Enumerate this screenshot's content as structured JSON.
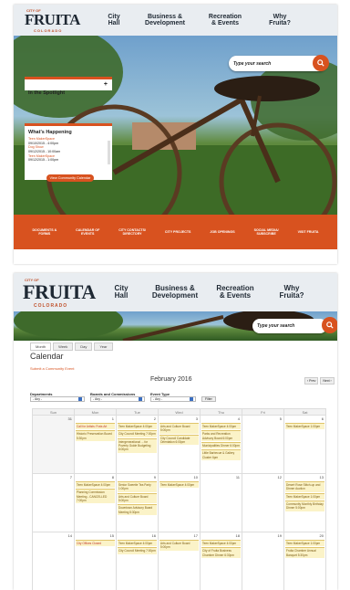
{
  "site": {
    "city_of": "City of",
    "name": "FRUITA",
    "state": "COLORADO"
  },
  "nav": [
    {
      "label": "City\nHall"
    },
    {
      "label": "Business &\nDevelopment"
    },
    {
      "label": "Recreation\n& Events"
    },
    {
      "label": "Why\nFruita?"
    }
  ],
  "search": {
    "placeholder": "Type your search",
    "icon": "magnifier-icon"
  },
  "home": {
    "spotlight_title": "In the Spotlight",
    "spotlight_toggle": "+",
    "happening_title": "What's Happening",
    "happening_items": [
      {
        "title": "Teen MakerSpace",
        "date": "09/10/2015 - 4:00pm"
      },
      {
        "title": "Dog Show",
        "date": "09/12/2015 - 10:00am"
      },
      {
        "title": "Teen MakerSpace",
        "date": "09/12/2015 - 1:00pm"
      }
    ],
    "view_calendar_button": "View Community Calendar",
    "quicklinks": [
      "DOCUMENTS &\nFORMS",
      "CALENDAR OF\nEVENTS",
      "CITY CONTACTS/\nDIRECTORY",
      "CITY PROJECTS",
      "JOB OPENINGS",
      "SOCIAL MEDIA/\nSUBSCRIBE",
      "VISIT FRUITA"
    ]
  },
  "calendar": {
    "tabs": [
      "Month",
      "Week",
      "Day",
      "Year"
    ],
    "active_tab": "Month",
    "page_title": "Calendar",
    "submit_link": "Submit a Community Event",
    "month_title": "February 2016",
    "prev": "‹ Prev",
    "next": "Next ›",
    "filters": [
      {
        "label": "Departments",
        "value": "- Any -"
      },
      {
        "label": "Boards and Commissions",
        "value": "- Any -"
      },
      {
        "label": "Event Type",
        "value": "- Any -"
      }
    ],
    "filter_button": "Filter",
    "weekdays": [
      "Sun",
      "Mon",
      "Tue",
      "Wed",
      "Thu",
      "Fri",
      "Sat"
    ],
    "weeks": [
      [
        {
          "day": "31",
          "other": true,
          "events": []
        },
        {
          "day": "1",
          "events": [
            {
              "t": "Call for Artists: Frais Art",
              "red": true
            },
            {
              "t": "Historic Preservation Board 5:30pm"
            }
          ]
        },
        {
          "day": "2",
          "events": [
            {
              "t": "Teen MakerSpace 4:00pm"
            },
            {
              "t": "City Council Meeting 7:00pm"
            },
            {
              "t": "Intergenerational ... for Poverty Guide Budgeting 6:00pm"
            }
          ]
        },
        {
          "day": "3",
          "events": [
            {
              "t": "Arts and Culture Board 5:00pm"
            },
            {
              "t": "City Council Candidate Orientation 6:00pm"
            }
          ]
        },
        {
          "day": "4",
          "events": [
            {
              "t": "Teen MakerSpace 4:00pm"
            },
            {
              "t": "Parks and Recreation Advisory Board 6:00pm"
            },
            {
              "t": "Municipalities Dinner 6:00pm"
            },
            {
              "t": "Little Barbecue & Gallery Cluster 6pm"
            }
          ]
        },
        {
          "day": "5",
          "events": []
        },
        {
          "day": "6",
          "events": [
            {
              "t": "Teen MakerSpace 1:00pm"
            }
          ]
        }
      ],
      [
        {
          "day": "7",
          "events": []
        },
        {
          "day": "8",
          "events": [
            {
              "t": "Teen MakerSpace 4:00pm"
            },
            {
              "t": "Planning Commission Meeting - CANCELLED 7:00pm"
            }
          ]
        },
        {
          "day": "9",
          "events": [
            {
              "t": "Senior Sweetie Tea Party 1:00pm"
            },
            {
              "t": "Arts and Culture Board 5:00pm"
            },
            {
              "t": "Downtown Advisory Board Meeting 5:30pm"
            }
          ]
        },
        {
          "day": "10",
          "events": [
            {
              "t": "Teen MakerSpace 4:00pm"
            }
          ]
        },
        {
          "day": "11",
          "events": []
        },
        {
          "day": "12",
          "events": []
        },
        {
          "day": "13",
          "events": [
            {
              "t": "Desert Rose Stitch-up and Dinner Auction"
            },
            {
              "t": "Teen MakerSpace 1:00pm"
            },
            {
              "t": "Community Monthly Birthday Dinner 5:00pm"
            }
          ]
        }
      ],
      [
        {
          "day": "14",
          "events": []
        },
        {
          "day": "15",
          "events": [
            {
              "t": "City Offices Closed",
              "red": true
            }
          ]
        },
        {
          "day": "16",
          "events": [
            {
              "t": "Teen MakerSpace 4:00pm"
            },
            {
              "t": "City Council Meeting 7:00pm"
            }
          ]
        },
        {
          "day": "17",
          "events": [
            {
              "t": "Arts and Culture Board 5:00pm"
            }
          ]
        },
        {
          "day": "18",
          "events": [
            {
              "t": "Teen MakerSpace 4:00pm"
            },
            {
              "t": "City of Fruita Business Chamber Dinner 6:30pm"
            }
          ]
        },
        {
          "day": "19",
          "events": []
        },
        {
          "day": "20",
          "events": [
            {
              "t": "Teen MakerSpace 1:00pm"
            },
            {
              "t": "Fruita Chamber Annual Banquet 5:30pm"
            }
          ]
        }
      ]
    ]
  },
  "colors": {
    "accent": "#d8521f",
    "navy": "#1e2833",
    "header_bg": "#e9edf1",
    "event_bg": "#fbf3c8"
  }
}
